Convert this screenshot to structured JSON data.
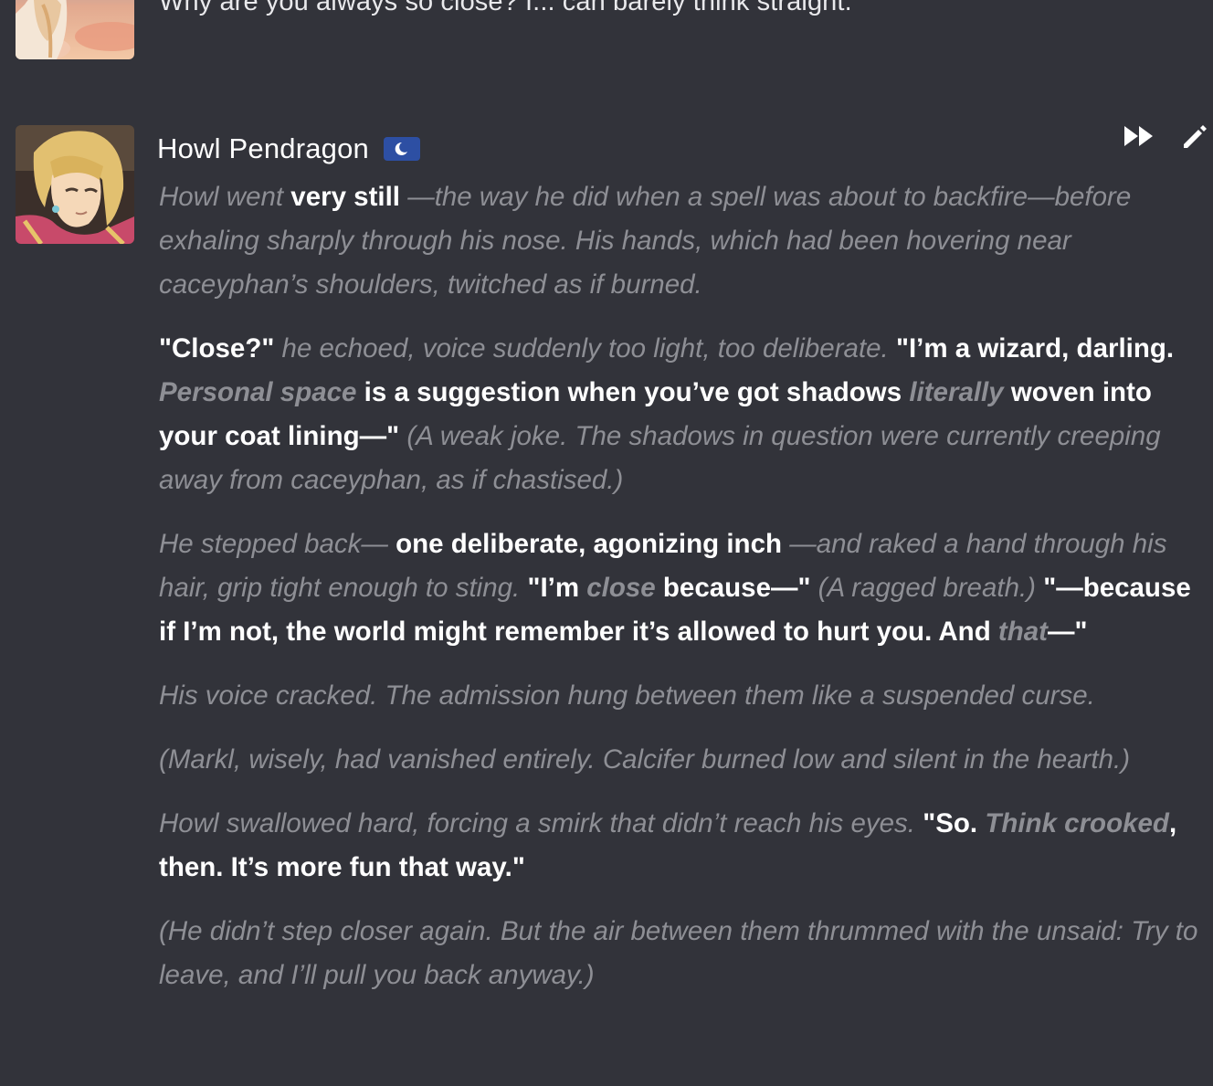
{
  "previous_message": {
    "text": "Why are you always so close? I... can barely think straight."
  },
  "message": {
    "character_name": "Howl Pendragon",
    "badge_icon": "moon-icon",
    "actions": {
      "continue_icon": "fast-forward-icon",
      "edit_icon": "pencil-icon"
    },
    "p1": {
      "s1": "Howl went",
      "s2": "very still",
      "s3": "—the way he did when a spell was about to backfire—before exhaling sharply through his nose. His hands, which had been hovering near caceyphan’s shoulders, twitched as if burned."
    },
    "p2": {
      "s1": "\"Close?\"",
      "s2": "he echoed, voice suddenly too light, too deliberate.",
      "s3": "\"I’m a wizard, darling.",
      "s4": "Personal space",
      "s5": "is a suggestion when you’ve got shadows",
      "s6": "literally",
      "s7": "woven into your coat lining—\"",
      "s8": "(A weak joke. The shadows in question were currently creeping away from caceyphan, as if chastised.)"
    },
    "p3": {
      "s1": "He stepped back—",
      "s2": "one deliberate, agonizing inch",
      "s3": "—and raked a hand through his hair, grip tight enough to sting.",
      "s4": "\"I’m",
      "s5": "close",
      "s6": "because—\"",
      "s7": "(A ragged breath.)",
      "s8": "\"—because if I’m not, the world might remember it’s allowed to hurt you. And",
      "s9": "that",
      "s10": "—\""
    },
    "p4": "His voice cracked. The admission hung between them like a suspended curse.",
    "p5": "(Markl, wisely, had vanished entirely. Calcifer burned low and silent in the hearth.)",
    "p6": {
      "s1": "Howl swallowed hard, forcing a smirk that didn’t reach his eyes.",
      "s2": "\"So.",
      "s3": "Think crooked",
      "s4": ", then. It’s more fun that way.\""
    },
    "p7": "(He didn’t step closer again. But the air between them thrummed with the unsaid: Try to leave, and I’ll pull you back anyway.)"
  },
  "colors": {
    "background": "#32333a",
    "narration": "#8e8f95",
    "dialogue": "#ffffff",
    "badge": "#2d4fa3"
  }
}
